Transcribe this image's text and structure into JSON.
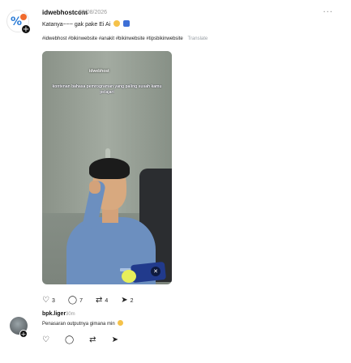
{
  "post": {
    "username": "idwebhostcom",
    "date": "20/08/2026",
    "caption": "Katanya~~~ gak pake Ei Ai",
    "hashtags": "#idwebhost #bikinwebsite #anakit #bikinwebsite #tipsbikinwebsite",
    "translate_label": "Translate",
    "media": {
      "overlay_logo": "idwebhost",
      "overlay_text": "kontenan bahasa pemrograman yang paling susah kamu pelajari"
    },
    "counts": {
      "likes": "3",
      "replies": "7",
      "reposts": "4",
      "shares": "2"
    }
  },
  "reply": {
    "username": "bpk.liger",
    "time": "30m",
    "text": "Penasaran outputnya gimana min"
  },
  "icons": {
    "like": "heart-icon",
    "reply": "comment-icon",
    "repost": "repost-icon",
    "share": "send-icon",
    "more": "more-icon",
    "mute": "mute-icon"
  }
}
